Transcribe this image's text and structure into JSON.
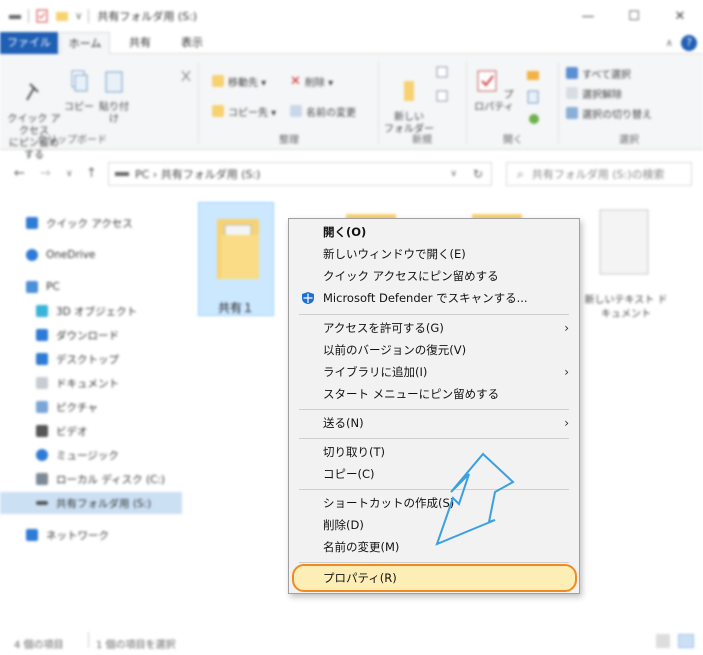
{
  "window": {
    "title": "共有フォルダ用 (S:)",
    "controls": {
      "minimize": "—",
      "maximize": "☐",
      "close": "✕"
    }
  },
  "tabs": [
    {
      "label": "ファイル"
    },
    {
      "label": "ホーム"
    },
    {
      "label": "共有"
    },
    {
      "label": "表示"
    }
  ],
  "ribbon": {
    "clipboard": {
      "group_label": "クリップボード",
      "pin_label": "クイック アクセス\nにピン留めする",
      "copy_label": "コピー",
      "paste_label": "貼り付け"
    },
    "organize": {
      "group_label": "整理",
      "move_label": "移動先 ▾",
      "copyto_label": "コピー先 ▾",
      "delete_label": "削除 ▾",
      "rename_label": "名前の変更"
    },
    "new": {
      "group_label": "新規",
      "newfolder_label": "新しい\nフォルダー"
    },
    "open": {
      "group_label": "開く",
      "properties_label": "プロパティ"
    },
    "select": {
      "group_label": "選択",
      "selectall_label": "すべて選択",
      "selectnone_label": "選択解除",
      "invert_label": "選択の切り替え"
    }
  },
  "address": {
    "path": "PC  ›  共有フォルダ用 (S:)",
    "search_placeholder": "共有フォルダ用 (S:)の検索"
  },
  "nav": [
    {
      "label": "クイック アクセス"
    },
    {
      "label": "OneDrive"
    },
    {
      "label": "PC"
    },
    {
      "label": "3D オブジェクト"
    },
    {
      "label": "ダウンロード"
    },
    {
      "label": "デスクトップ"
    },
    {
      "label": "ドキュメント"
    },
    {
      "label": "ピクチャ"
    },
    {
      "label": "ビデオ"
    },
    {
      "label": "ミュージック"
    },
    {
      "label": "ローカル ディスク (C:)"
    },
    {
      "label": "共有フォルダ用 (S:)"
    },
    {
      "label": "ネットワーク"
    }
  ],
  "files": [
    {
      "label": "共有１"
    },
    {
      "label": "新しいテキスト ドキュメント"
    }
  ],
  "status": {
    "item_count": "4 個の項目",
    "selected": "1 個の項目を選択"
  },
  "context_menu": {
    "items": [
      {
        "label": "開く(O)"
      },
      {
        "label": "新しいウィンドウで開く(E)"
      },
      {
        "label": "クイック アクセスにピン留めする"
      },
      {
        "label": "Microsoft Defender でスキャンする..."
      },
      {
        "label": "アクセスを許可する(G)"
      },
      {
        "label": "以前のバージョンの復元(V)"
      },
      {
        "label": "ライブラリに追加(I)"
      },
      {
        "label": "スタート メニューにピン留めする"
      },
      {
        "label": "送る(N)"
      },
      {
        "label": "切り取り(T)"
      },
      {
        "label": "コピー(C)"
      },
      {
        "label": "ショートカットの作成(S)"
      },
      {
        "label": "削除(D)"
      },
      {
        "label": "名前の変更(M)"
      },
      {
        "label": "プロパティ(R)"
      }
    ],
    "submenu_arrow": "›"
  },
  "colors": {
    "accent": "#1f5fb4",
    "highlight_border": "#f08a24",
    "highlight_fill": "#fdeeb6",
    "annotation_arrow": "#3aa0e0",
    "folder": "#f7d272"
  }
}
